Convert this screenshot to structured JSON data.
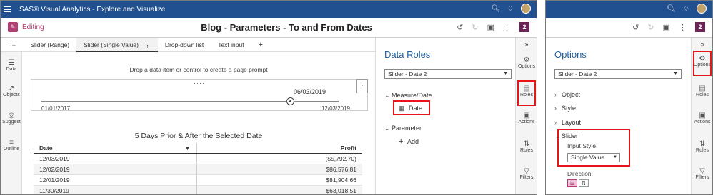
{
  "app": {
    "title": "SAS® Visual Analytics - Explore and Visualize",
    "title_right": ""
  },
  "toolbar": {
    "editing_label": "Editing",
    "report_title": "Blog - Parameters - To and From Dates",
    "page_badge": "2"
  },
  "tabs": [
    {
      "label": "····"
    },
    {
      "label": "Slider (Range)"
    },
    {
      "label": "Slider (Single Value)"
    },
    {
      "label": "Drop-down list"
    },
    {
      "label": "Text input"
    },
    {
      "label": "+"
    }
  ],
  "sidenav": [
    {
      "label": "Data",
      "icon": "database-icon"
    },
    {
      "label": "Objects",
      "icon": "chart-icon"
    },
    {
      "label": "Suggest",
      "icon": "lightbulb-icon"
    },
    {
      "label": "Outline",
      "icon": "list-icon"
    }
  ],
  "canvas": {
    "prompt_text": "Drop a data item or control to create a page prompt",
    "slider_dots": "····",
    "slider_selected": "06/03/2019",
    "slider_min": "01/01/2017",
    "slider_max": "12/03/2019",
    "table_title": "5 Days Prior & After the Selected Date",
    "table_headers": [
      "Date",
      "Profit"
    ],
    "table_rows": [
      [
        "12/03/2019",
        "($5,792.70)"
      ],
      [
        "12/02/2019",
        "$86,576.81"
      ],
      [
        "12/01/2019",
        "$81,904.66"
      ],
      [
        "11/30/2019",
        "$63,018.51"
      ]
    ]
  },
  "data_roles": {
    "title": "Data Roles",
    "object_select": "Slider - Date 2",
    "section_measure": "Measure/Date",
    "role_value": "Date",
    "section_parameter": "Parameter",
    "add_label": "Add"
  },
  "right_strip_left": [
    {
      "label": "Options",
      "icon": "options-icon"
    },
    {
      "label": "Roles",
      "icon": "roles-icon"
    },
    {
      "label": "Actions",
      "icon": "actions-icon"
    },
    {
      "label": "Rules",
      "icon": "rules-icon"
    },
    {
      "label": "Filters",
      "icon": "filter-icon"
    }
  ],
  "options": {
    "title": "Options",
    "object_select": "Slider - Date 2",
    "sections": [
      "Object",
      "Style",
      "Layout",
      "Slider"
    ],
    "input_style_label": "Input Style:",
    "input_style_value": "Single Value",
    "direction_label": "Direction:"
  },
  "colors": {
    "topbar": "#20508f",
    "accent": "#1e5f9e",
    "highlight": "#e8141b",
    "editing": "#b23c6f"
  }
}
